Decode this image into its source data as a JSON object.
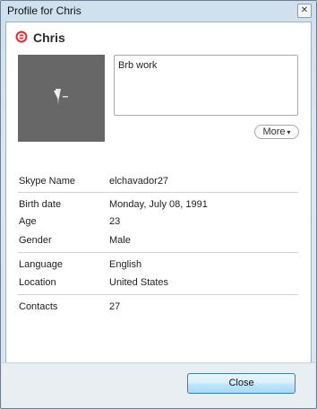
{
  "window": {
    "title": "Profile for Chris",
    "close_glyph": "✕"
  },
  "profile": {
    "name": "Chris",
    "status_icon": "skype-status-icon",
    "status_color": "#e0323c",
    "avatar_icon": "pontiac-logo-icon",
    "mood_message": "Brb work",
    "more_label": "More",
    "more_chevron": "▾"
  },
  "details": [
    {
      "label": "Skype Name",
      "value": "elchavador27"
    },
    {
      "label": "Birth date",
      "value": "Monday, July 08, 1991"
    },
    {
      "label": "Age",
      "value": "23"
    },
    {
      "label": "Gender",
      "value": "Male"
    },
    {
      "label": "Language",
      "value": "English"
    },
    {
      "label": "Location",
      "value": "United States"
    },
    {
      "label": "Contacts",
      "value": "27"
    }
  ],
  "footer": {
    "close_label": "Close"
  }
}
